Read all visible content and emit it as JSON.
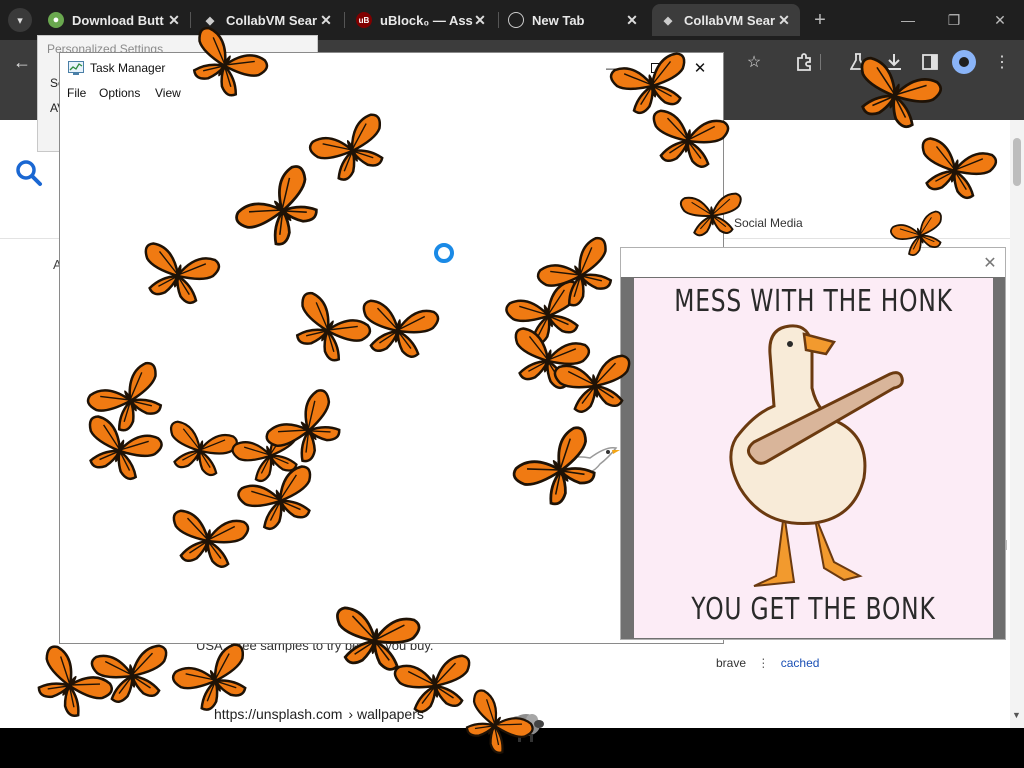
{
  "browser": {
    "tabs": [
      {
        "label": "Download Butt",
        "icon": "green-globe-icon",
        "active": false
      },
      {
        "label": "CollabVM Sear",
        "icon": "collabvm-icon",
        "active": false
      },
      {
        "label": "uBlock₀ — Ass",
        "icon": "ublock-icon",
        "active": false
      },
      {
        "label": "New Tab",
        "icon": "globe-icon",
        "active": false
      },
      {
        "label": "CollabVM Sear",
        "icon": "collabvm-icon",
        "active": true
      }
    ],
    "toolbar_icons": [
      "back-arrow-icon",
      "star-icon",
      "extensions-icon",
      "labs-flask-icon",
      "download-icon",
      "sidebar-icon",
      "profile-icon",
      "menu-dots-icon"
    ]
  },
  "personalized_settings": {
    "title": "Personalized Settings",
    "row1": "Se",
    "row2": "AV"
  },
  "task_manager": {
    "title": "Task Manager",
    "menu": [
      "File",
      "Options",
      "View"
    ],
    "minimize": "—",
    "close": "✕"
  },
  "webpage": {
    "nav_social": "Social Media",
    "stray_letter": "A",
    "snippet": "USA. Free samples to try before you buy.",
    "meta_brave": "brave",
    "meta_dots": "⋮",
    "meta_cached": "cached",
    "url_host": "https://unsplash.com",
    "url_crumb": "› wallpapers"
  },
  "meme": {
    "top_text": "MESS WITH THE HONK",
    "bottom_text": "YOU GET THE BONK",
    "close": "✕"
  },
  "colors": {
    "butterfly_orange": "#f07a12",
    "butterfly_dark": "#1e1206",
    "spinner_blue": "#1a8ae6",
    "meme_pink": "#fcecf6",
    "chrome_dark": "#1f1f1f",
    "toolbar": "#3c3c3c"
  }
}
